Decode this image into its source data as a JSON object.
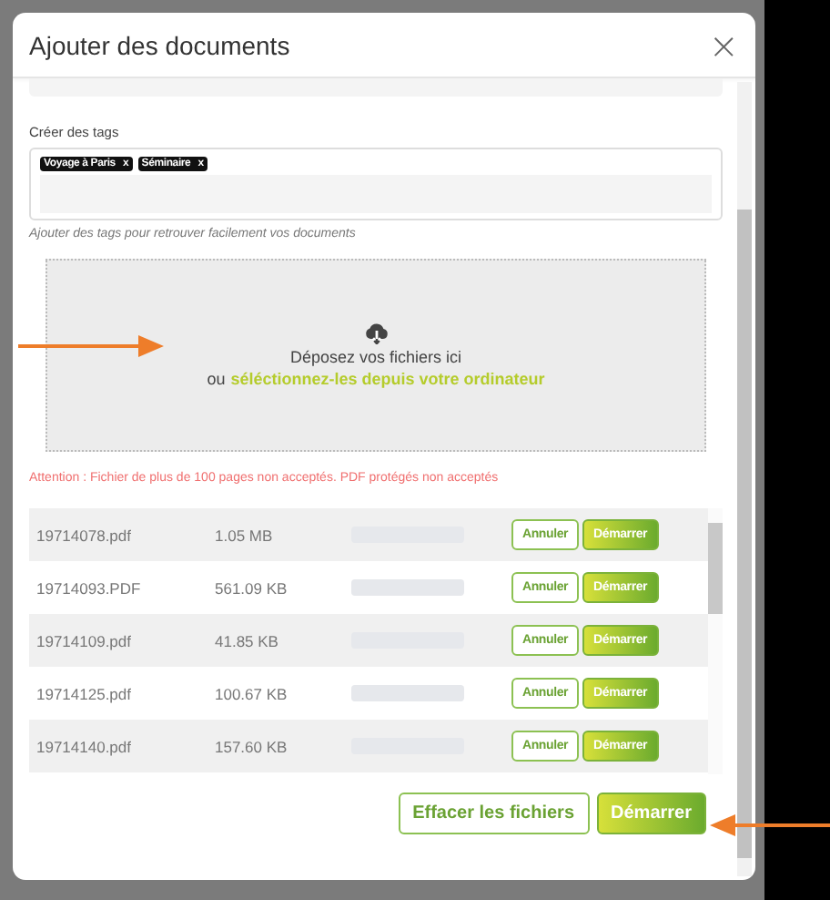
{
  "dialog": {
    "title": "Ajouter des documents",
    "close": "×"
  },
  "tags": {
    "label": "Créer des tags",
    "items": [
      {
        "text": "Voyage à Paris",
        "remove": "x"
      },
      {
        "text": "Séminaire",
        "remove": "x"
      }
    ],
    "hint": "Ajouter des tags pour retrouver facilement vos documents"
  },
  "dropzone": {
    "title": "Déposez vos fichiers ici",
    "prefix": "ou",
    "link": "séléctionnez-les depuis votre ordinateur"
  },
  "warning": "Attention : Fichier de plus de 100 pages non acceptés. PDF protégés non acceptés",
  "files": [
    {
      "name": "19714078.pdf",
      "size": "1.05 MB",
      "level": 0,
      "cancel": "Annuler",
      "start": "Démarrer"
    },
    {
      "name": "19714093.PDF",
      "size": "561.09 KB",
      "level": 0,
      "cancel": "Annuler",
      "start": "Démarrer"
    },
    {
      "name": "19714109.pdf",
      "size": "41.85 KB",
      "level": 0,
      "cancel": "Annuler",
      "start": "Démarrer"
    },
    {
      "name": "19714125.pdf",
      "size": "100.67 KB",
      "level": 0,
      "cancel": "Annuler",
      "start": "Démarrer"
    },
    {
      "name": "19714140.pdf",
      "size": "157.60 KB",
      "level": 0,
      "cancel": "Annuler",
      "start": "Démarrer"
    }
  ],
  "footer": {
    "clear": "Effacer les fichiers",
    "start": "Démarrer"
  }
}
